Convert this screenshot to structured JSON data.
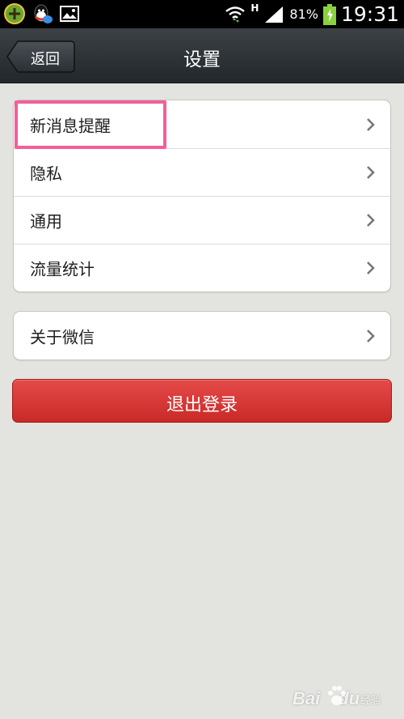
{
  "status_bar": {
    "network_type": "H",
    "battery_percent": "81%",
    "time": "19:31",
    "icons": [
      "app-icon",
      "qq-icon",
      "image-icon",
      "wifi-icon",
      "signal-icon",
      "battery-icon"
    ]
  },
  "header": {
    "back_label": "返回",
    "title": "设置"
  },
  "groups": {
    "main": [
      {
        "label": "新消息提醒"
      },
      {
        "label": "隐私"
      },
      {
        "label": "通用"
      },
      {
        "label": "流量统计"
      }
    ],
    "about": [
      {
        "label": "关于微信"
      }
    ]
  },
  "logout_label": "退出登录",
  "watermark": {
    "brand": "Bai",
    "brand_suffix": "du",
    "sub": "经验"
  },
  "colors": {
    "accent_red": "#d83533",
    "highlight_pink": "#f35f9b",
    "page_bg": "#e3e3df"
  }
}
